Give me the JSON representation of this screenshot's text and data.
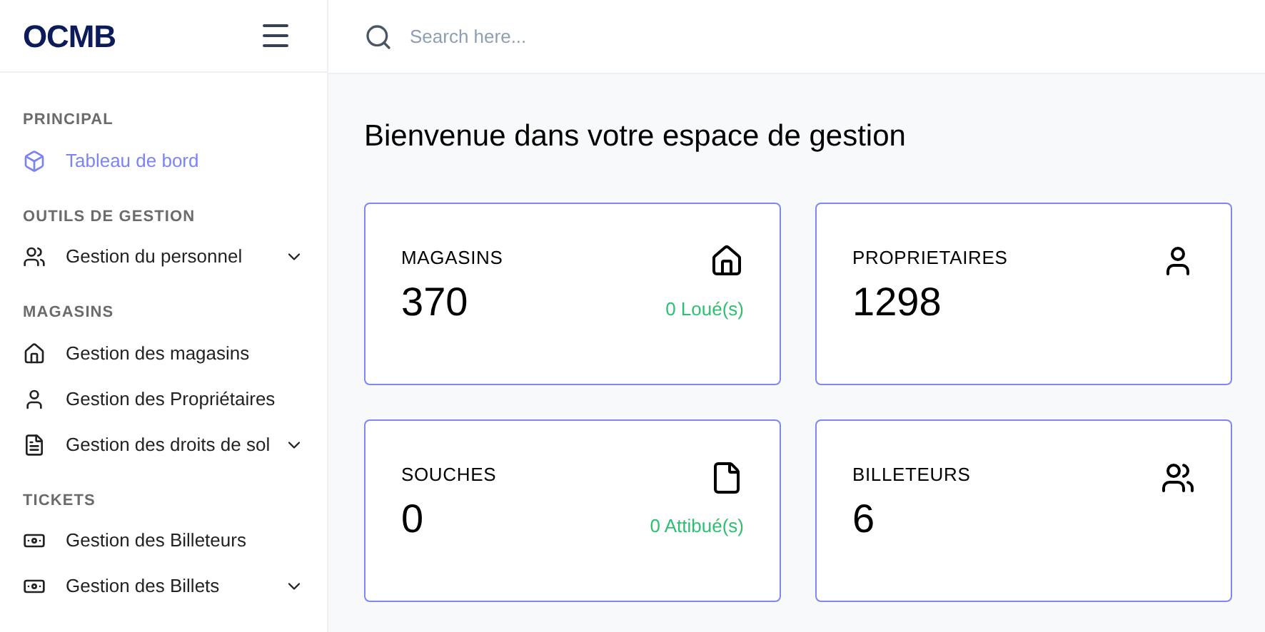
{
  "logo": "OCMB",
  "search": {
    "placeholder": "Search here..."
  },
  "sidebar": {
    "sections": [
      {
        "title": "PRINCIPAL",
        "items": [
          {
            "label": "Tableau de bord",
            "kind": "box",
            "selected": true,
            "expandable": false
          }
        ]
      },
      {
        "title": "OUTILS DE GESTION",
        "items": [
          {
            "label": "Gestion du personnel",
            "kind": "users",
            "selected": false,
            "expandable": true
          }
        ]
      },
      {
        "title": "MAGASINS",
        "items": [
          {
            "label": "Gestion des magasins",
            "kind": "home",
            "selected": false,
            "expandable": false
          },
          {
            "label": "Gestion des Propriétaires",
            "kind": "user",
            "selected": false,
            "expandable": false
          },
          {
            "label": "Gestion des droits de sol",
            "kind": "document",
            "selected": false,
            "expandable": true
          }
        ]
      },
      {
        "title": "TICKETS",
        "items": [
          {
            "label": "Gestion des Billeteurs",
            "kind": "banknote",
            "selected": false,
            "expandable": false
          },
          {
            "label": "Gestion des Billets",
            "kind": "banknote",
            "selected": false,
            "expandable": true
          }
        ]
      }
    ]
  },
  "heading": "Bienvenue dans votre espace de gestion",
  "cards": [
    {
      "title": "MAGASINS",
      "value": "370",
      "note": "0 Loué(s)",
      "kind": "home"
    },
    {
      "title": "PROPRIETAIRES",
      "value": "1298",
      "kind": "user"
    },
    {
      "title": "SOUCHES",
      "value": "0",
      "note": "0 Attibué(s)",
      "kind": "file"
    },
    {
      "title": "BILLETEURS",
      "value": "6",
      "kind": "users"
    }
  ]
}
